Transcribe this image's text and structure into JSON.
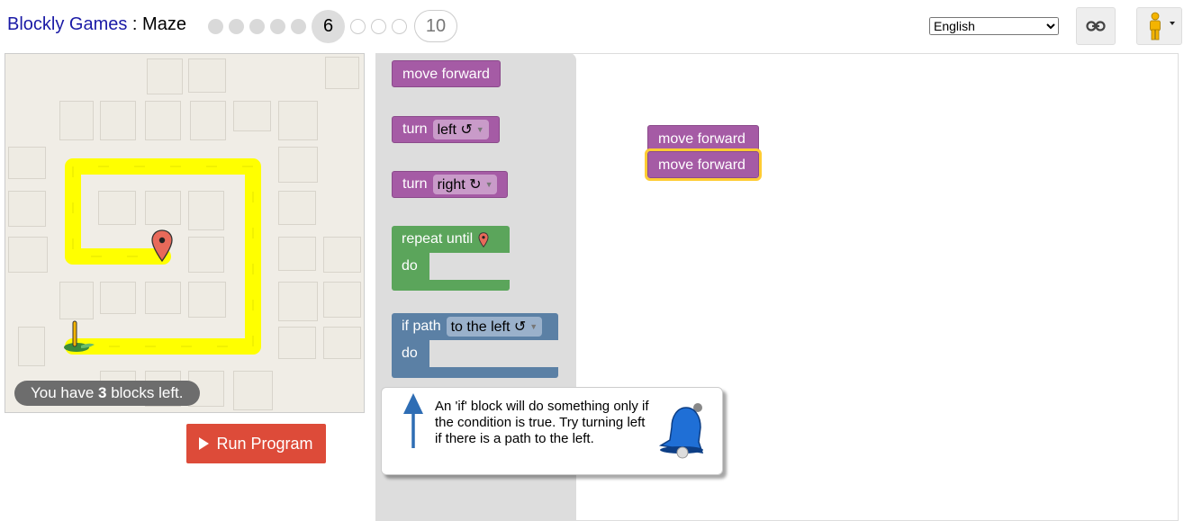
{
  "header": {
    "brand": "Blockly Games",
    "separator": " : ",
    "game": "Maze",
    "levels": {
      "current": "6",
      "last": "10"
    },
    "language": {
      "selected": "English"
    },
    "link_icon": "link-icon",
    "pegman_icon": "pegman-icon"
  },
  "maze": {
    "status_prefix": "You have ",
    "blocks_left": "3",
    "status_suffix": " blocks left.",
    "path_color": "#ffff00",
    "marker_icon": "map-marker-icon",
    "start_icon": "pegman-start-icon"
  },
  "run_button": {
    "label": "Run Program"
  },
  "toolbox": {
    "move_forward": "move forward",
    "turn_label": "turn",
    "turn_left": "left ↺",
    "turn_right": "right ↻",
    "repeat_until": "repeat until",
    "do_label": "do",
    "if_path": "if path",
    "if_option": "to the left ↺",
    "if_do": "do"
  },
  "workspace": {
    "block1": "move forward",
    "block2": "move forward"
  },
  "tooltip": {
    "text": "An 'if' block will do something only if the condition is true. Try turning left if there is a path to the left.",
    "arrow_icon": "up-arrow-icon",
    "bell_icon": "bell-icon"
  },
  "colors": {
    "motion_blocks": "#a55ba5",
    "loop_blocks": "#5ba55b",
    "logic_blocks": "#5b80a5",
    "run_button": "#dd4b39",
    "brand": "#1a1aa6"
  }
}
